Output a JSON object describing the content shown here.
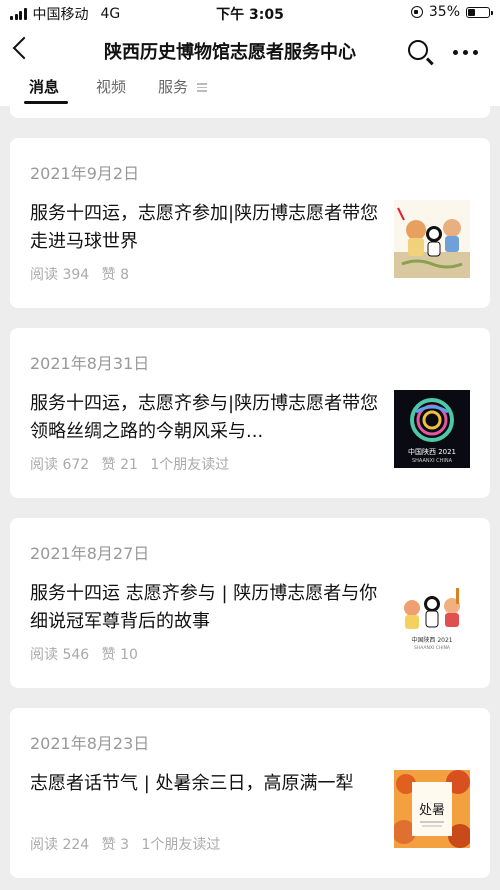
{
  "status": {
    "carrier": "中国移动",
    "network": "4G",
    "time": "下午 3:05",
    "battery": "35%",
    "battery_level": 0.35
  },
  "header": {
    "title": "陕西历史博物馆志愿者服务中心"
  },
  "tabs": [
    {
      "label": "消息"
    },
    {
      "label": "视频"
    },
    {
      "label": "服务"
    }
  ],
  "articles": [
    {
      "date": "2021年9月2日",
      "title": "服务十四运，志愿齐参加|陕历博志愿者带您走进马球世界",
      "reads": "阅读 394",
      "likes": "赞 8",
      "friends": ""
    },
    {
      "date": "2021年8月31日",
      "title": "服务十四运，志愿齐参与|陕历博志愿者带您领略丝绸之路的今朝风采与...",
      "reads": "阅读 672",
      "likes": "赞 21",
      "friends": "1个朋友读过"
    },
    {
      "date": "2021年8月27日",
      "title": "服务十四运 志愿齐参与 | 陕历博志愿者与你细说冠军尊背后的故事",
      "reads": "阅读 546",
      "likes": "赞 10",
      "friends": ""
    },
    {
      "date": "2021年8月23日",
      "title": "志愿者话节气 | 处暑余三日，高原满一犁",
      "reads": "阅读 224",
      "likes": "赞 3",
      "friends": "1个朋友读过"
    }
  ],
  "thumb_text": {
    "t2_line1": "中国陕西 2021",
    "t2_line2": "SHAANXI CHINA",
    "t3_line1": "中国陕西 2021",
    "t3_line2": "SHAANXI CHINA",
    "t4_title": "处暑"
  }
}
